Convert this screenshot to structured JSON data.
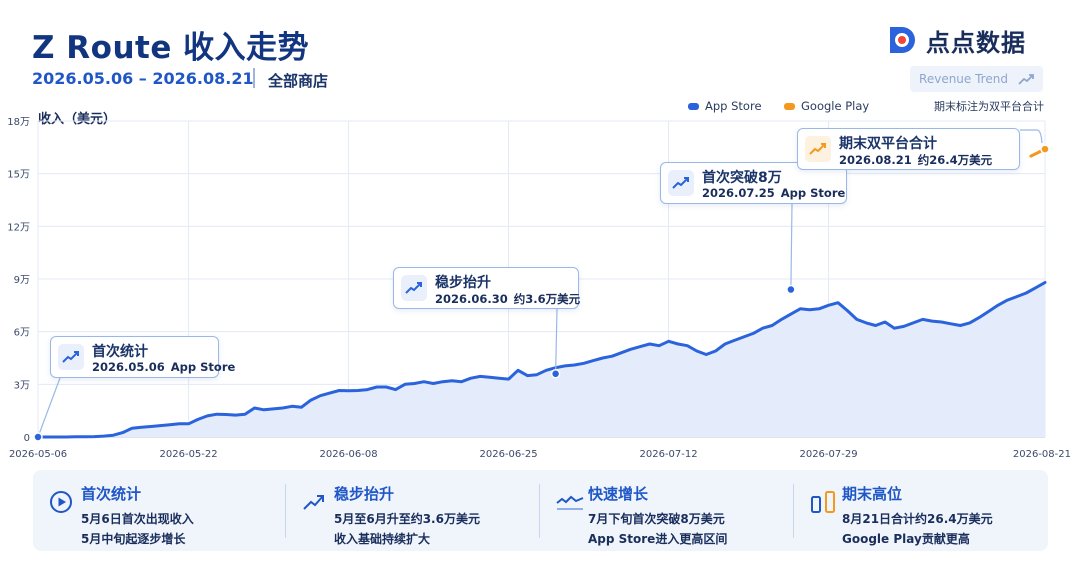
{
  "header": {
    "title": "Z Route 收入走势",
    "date_range": "2026.05.06 – 2026.08.21",
    "store": "全部商店",
    "brand": "点点数据",
    "trend_button": "Revenue Trend"
  },
  "legend": {
    "app_store": "App Store",
    "google_play": "Google Play",
    "note": "期末标注为双平台合计"
  },
  "colors": {
    "app_store": "#2a63dc",
    "google_play": "#f39a1e",
    "area": "#e4ebfa",
    "grid": "#e3eaf6",
    "annotation_border": "#9ab8e6"
  },
  "chart_data": {
    "type": "line",
    "ylabel": "收入（美元）",
    "ylim": [
      0,
      180000
    ],
    "y_ticks": [
      0,
      30000,
      60000,
      90000,
      120000,
      150000,
      180000
    ],
    "y_tick_labels": [
      "0",
      "3万",
      "6万",
      "9万",
      "12万",
      "15万",
      "18万"
    ],
    "x_tick_labels": [
      "2026-05-06",
      "2026-05-22",
      "2026-06-08",
      "2026-06-25",
      "2026-07-12",
      "2026-07-29",
      "2026-08-21"
    ],
    "x_tick_days": [
      0,
      16,
      33,
      50,
      67,
      84,
      107
    ],
    "xlim_days": [
      0,
      107
    ],
    "grid": true,
    "legend_position": "top-right",
    "series": [
      {
        "name": "App Store",
        "days": [
          0,
          1,
          2,
          3,
          4,
          5,
          6,
          7,
          8,
          9,
          10,
          11,
          12,
          13,
          14,
          15,
          16,
          17,
          18,
          19,
          20,
          21,
          22,
          23,
          24,
          25,
          26,
          27,
          28,
          29,
          30,
          31,
          32,
          33,
          34,
          35,
          36,
          37,
          38,
          39,
          40,
          41,
          42,
          43,
          44,
          45,
          46,
          47,
          48,
          49,
          50,
          51,
          52,
          53,
          54,
          55,
          56,
          57,
          58,
          59,
          60,
          61,
          62,
          63,
          64,
          65,
          66,
          67,
          68,
          69,
          70,
          71,
          72,
          73,
          74,
          75,
          76,
          77,
          78,
          79,
          80,
          81,
          82,
          83,
          84,
          85,
          86,
          87,
          88,
          89,
          90,
          91,
          92,
          93,
          94,
          95,
          96,
          97,
          98,
          99,
          100,
          101,
          102,
          103,
          104,
          105,
          106,
          107
        ],
        "values": [
          0,
          0,
          0,
          0,
          100,
          100,
          200,
          500,
          1000,
          2500,
          5000,
          5500,
          6000,
          6500,
          7000,
          7500,
          7500,
          10000,
          12000,
          13000,
          12800,
          12500,
          13000,
          16500,
          15500,
          16000,
          16500,
          17500,
          17000,
          21000,
          23500,
          25000,
          26500,
          26300,
          26500,
          27000,
          28500,
          28500,
          27000,
          30000,
          30500,
          31500,
          30500,
          31500,
          32000,
          31500,
          33500,
          34500,
          34000,
          33500,
          33000,
          38000,
          35000,
          35500,
          38000,
          39500,
          40500,
          41000,
          42000,
          43500,
          45000,
          46000,
          48000,
          50000,
          51500,
          53000,
          52000,
          54500,
          53000,
          52000,
          49000,
          47000,
          49000,
          53000,
          55000,
          57000,
          59000,
          62000,
          63500,
          67000,
          70000,
          73000,
          72500,
          73000,
          75000,
          76500,
          72000,
          67000,
          65000,
          63500,
          65500,
          62000,
          63000,
          65000,
          67000,
          66000,
          65500,
          64500,
          63500,
          65000,
          68000,
          71500,
          75000,
          78000,
          80000,
          82000,
          85000,
          88000,
          91000,
          94000,
          97500,
          99000
        ]
      },
      {
        "name": "Google Play",
        "days": [
          105.5,
          107
        ],
        "values": [
          160000,
          164000
        ]
      }
    ],
    "annotations": [
      {
        "title": "首次统计",
        "date": "2026.05.06",
        "detail": "App Store",
        "day": 0,
        "value": 0
      },
      {
        "title": "稳步抬升",
        "date": "2026.06.30",
        "detail": "约3.6万美元",
        "day": 55,
        "value": 36000
      },
      {
        "title": "首次突破8万",
        "date": "2026.07.25",
        "detail": "App Store",
        "day": 80,
        "value": 84000
      },
      {
        "title": "期末双平台合计",
        "date": "2026.08.21",
        "detail": "约26.4万美元",
        "day": 107,
        "value": 164000
      }
    ]
  },
  "cards": [
    {
      "title": "首次统计",
      "line1": "5月6日首次出现收入",
      "line2": "5月中旬起逐步增长",
      "icon": "play-circle-icon"
    },
    {
      "title": "稳步抬升",
      "line1": "5月至6月升至约3.6万美元",
      "line2": "收入基础持续扩大",
      "icon": "trend-up-icon"
    },
    {
      "title": "快速增长",
      "line1": "7月下旬首次突破8万美元",
      "line2": "App Store进入更高区间",
      "icon": "wave-line-icon"
    },
    {
      "title": "期末高位",
      "line1": "8月21日合计约26.4万美元",
      "line2": "Google Play贡献更高",
      "icon": "bars-icon"
    }
  ]
}
